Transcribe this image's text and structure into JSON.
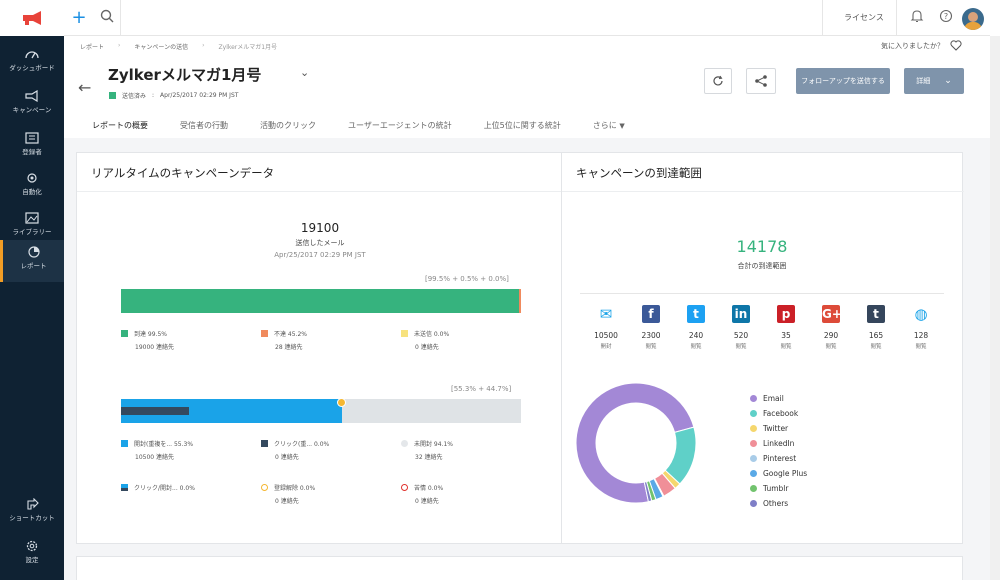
{
  "topbar": {
    "license": "ライセンス"
  },
  "sidebar": {
    "items": [
      {
        "label": "ダッシュボード",
        "icon": "dashboard-icon"
      },
      {
        "label": "キャンペーン",
        "icon": "megaphone-icon"
      },
      {
        "label": "登録者",
        "icon": "contacts-icon"
      },
      {
        "label": "自動化",
        "icon": "automation-icon"
      },
      {
        "label": "ライブラリー",
        "icon": "library-icon"
      },
      {
        "label": "レポート",
        "icon": "reports-icon",
        "active": true
      },
      {
        "label": "ショートカット",
        "icon": "shortcut-icon"
      },
      {
        "label": "設定",
        "icon": "settings-icon"
      }
    ]
  },
  "header": {
    "breadcrumb": [
      "レポート",
      "キャンペーンの送信",
      "Zylkerメルマガ1月号"
    ],
    "favorite_text": "気に入りましたか？",
    "title": "Zylkerメルマガ1月号",
    "status_label": "送信済み",
    "status_sep": ":",
    "status_date": "Apr/25/2017 02:29 PM JST",
    "followup_button": "フォローアップを送信する",
    "details_button": "詳細"
  },
  "tabs": [
    "レポートの概要",
    "受信者の行動",
    "活動のクリック",
    "ユーザーエージェントの統計",
    "上位5位に関する統計",
    "さらに"
  ],
  "realtime": {
    "title": "リアルタイムのキャンペーンデータ",
    "sent_count": "19100",
    "sent_label": "送信したメール",
    "sent_date": "Apr/25/2017 02:29 PM JST",
    "delivery_pct": "[99.5% + 0.5% + 0.0%]",
    "delivery_bar": [
      {
        "name": "delivered",
        "value": 99.5,
        "color": "#36b37e"
      },
      {
        "name": "bounced",
        "value": 0.5,
        "color": "#f08a5d"
      },
      {
        "name": "unsent",
        "value": 0.0,
        "color": "#f7d96b"
      }
    ],
    "delivery_legend": [
      {
        "label": "到達 99.5%",
        "count": "19000 連絡先",
        "color": "#36b37e"
      },
      {
        "label": "不達 45.2%",
        "count": "28 連絡先",
        "color": "#f08a5d"
      },
      {
        "label": "未送信 0.0%",
        "count": "0 連絡先",
        "color": "#f7e27e"
      }
    ],
    "open_pct": "[55.3% + 44.7%]",
    "open_bar": [
      {
        "name": "opened",
        "value": 55.3,
        "color": "#1aa3e8"
      },
      {
        "name": "unopened",
        "value": 44.7,
        "color": "#dfe3e6"
      }
    ],
    "open_inner_click": 17,
    "open_legend_row1": [
      {
        "label": "開封(重複を... 55.3%",
        "count": "10500 連絡先",
        "color": "#1aa3e8"
      },
      {
        "label": "クリック(重... 0.0%",
        "count": "0 連絡先",
        "color": "#34495e"
      },
      {
        "label": "未開封 94.1%",
        "count": "32 連絡先",
        "color": "#e4e7ea"
      }
    ],
    "open_legend_row2": [
      {
        "label": "クリック/開封... 0.0%",
        "count": "",
        "color": "#1aa3e8"
      },
      {
        "label": "登録解除 0.0%",
        "count": "0 連絡先",
        "color": "#f5b731"
      },
      {
        "label": "苦情 0.0%",
        "count": "0 連絡先",
        "color": "#e0322d"
      }
    ]
  },
  "reach": {
    "title": "キャンペーンの到達範囲",
    "total": "14178",
    "total_label": "合計の到達範囲",
    "channels": [
      {
        "name": "Email",
        "icon": "email-icon",
        "value": "10500",
        "sub": "開封",
        "color": "#1aa3e8"
      },
      {
        "name": "Facebook",
        "icon": "facebook-icon",
        "value": "2300",
        "sub": "閲覧",
        "color": "#3b5998"
      },
      {
        "name": "Twitter",
        "icon": "twitter-icon",
        "value": "240",
        "sub": "閲覧",
        "color": "#1da1f2"
      },
      {
        "name": "LinkedIn",
        "icon": "linkedin-icon",
        "value": "520",
        "sub": "閲覧",
        "color": "#0e76a8"
      },
      {
        "name": "Pinterest",
        "icon": "pinterest-icon",
        "value": "35",
        "sub": "閲覧",
        "color": "#cb2027"
      },
      {
        "name": "Google Plus",
        "icon": "google-plus-icon",
        "value": "290",
        "sub": "閲覧",
        "color": "#dd4b39"
      },
      {
        "name": "Tumblr",
        "icon": "tumblr-icon",
        "value": "165",
        "sub": "閲覧",
        "color": "#35465c"
      },
      {
        "name": "Others",
        "icon": "globe-icon",
        "value": "128",
        "sub": "閲覧",
        "color": "#1aa3e8"
      }
    ]
  },
  "chart_data": {
    "type": "pie",
    "title": "",
    "categories": [
      "Email",
      "Facebook",
      "Twitter",
      "LinkedIn",
      "Pinterest",
      "Google Plus",
      "Tumblr",
      "Others"
    ],
    "values": [
      10500,
      2300,
      240,
      520,
      35,
      290,
      165,
      128
    ],
    "colors": [
      "#a388d6",
      "#5fd0c8",
      "#f5d76e",
      "#f08f98",
      "#a9cce8",
      "#5aa9e6",
      "#72c36e",
      "#7f7fc7"
    ],
    "donut": true,
    "legend_position": "right"
  }
}
